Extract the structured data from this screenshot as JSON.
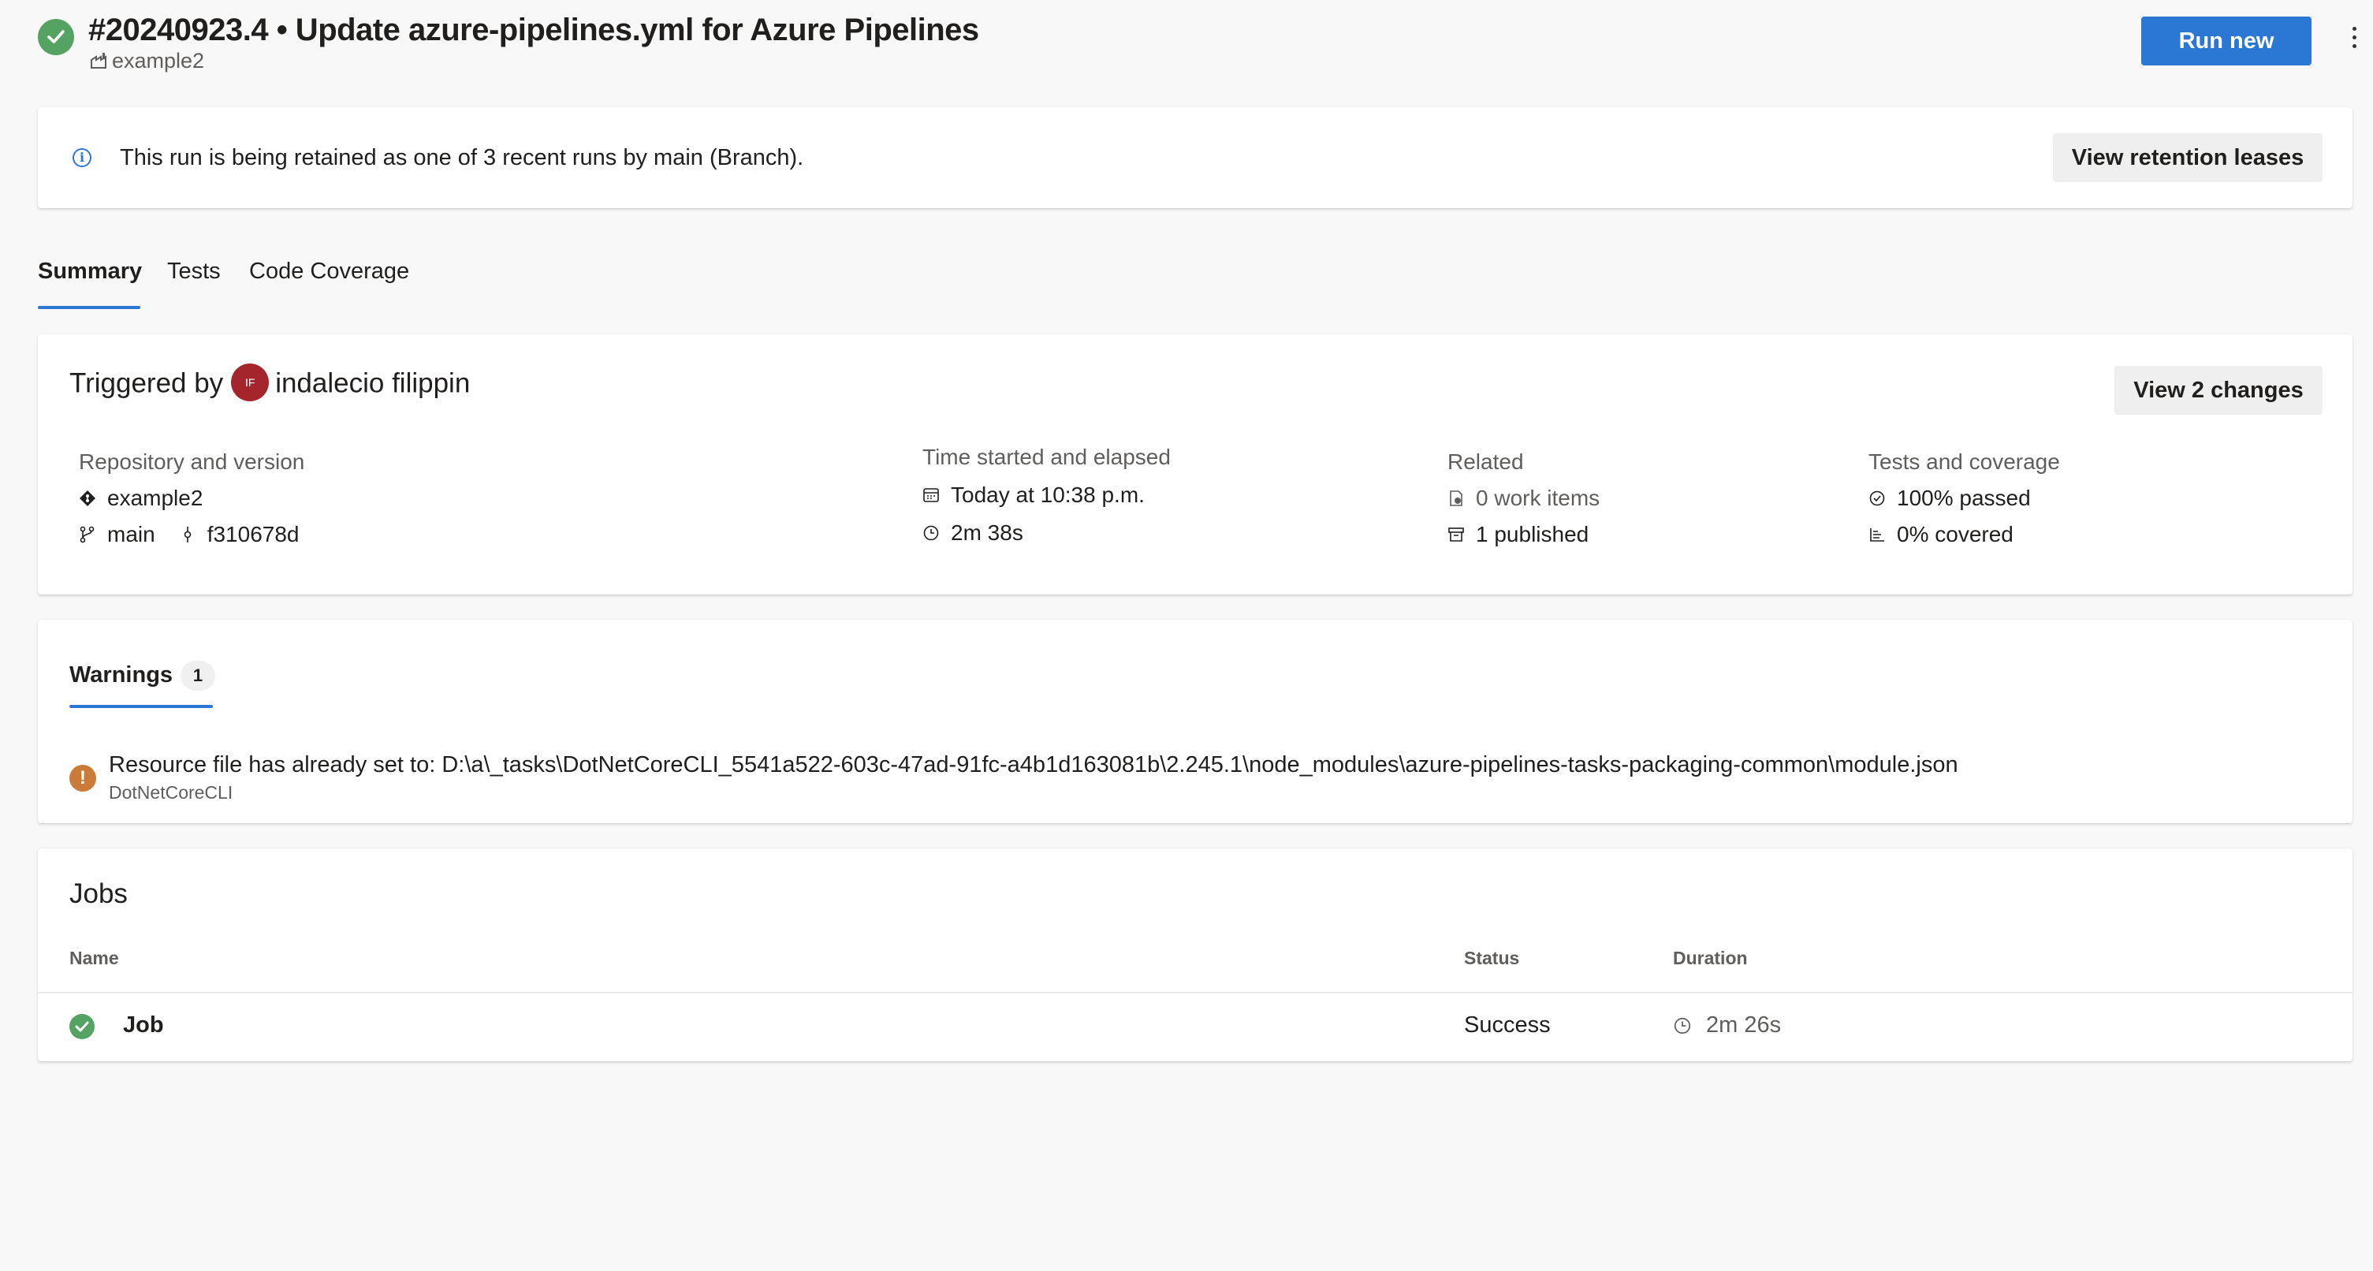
{
  "header": {
    "title": "#20240923.4 • Update azure-pipelines.yml for Azure Pipelines",
    "pipeline_name": "example2",
    "run_new_label": "Run new"
  },
  "banner": {
    "message": "This run is being retained as one of 3 recent runs by main (Branch).",
    "button_label": "View retention leases"
  },
  "tabs": [
    {
      "label": "Summary",
      "selected": true
    },
    {
      "label": "Tests",
      "selected": false
    },
    {
      "label": "Code Coverage",
      "selected": false
    }
  ],
  "summary": {
    "triggered_prefix": "Triggered by",
    "avatar_initials": "IF",
    "user_name": "indalecio filippin",
    "view_changes_label": "View 2 changes",
    "repository": {
      "label": "Repository and version",
      "repo_name": "example2",
      "branch": "main",
      "commit": "f310678d"
    },
    "time": {
      "label": "Time started and elapsed",
      "started": "Today at 10:38 p.m.",
      "elapsed": "2m 38s"
    },
    "related": {
      "label": "Related",
      "work_items": "0 work items",
      "published": "1 published"
    },
    "tests": {
      "label": "Tests and coverage",
      "passed": "100% passed",
      "covered": "0% covered"
    }
  },
  "warnings": {
    "tab_label": "Warnings",
    "count": "1",
    "items": [
      {
        "message": "Resource file has already set to: D:\\a\\_tasks\\DotNetCoreCLI_5541a522-603c-47ad-91fc-a4b1d163081b\\2.245.1\\node_modules\\azure-pipelines-tasks-packaging-common\\module.json",
        "source": "DotNetCoreCLI"
      }
    ]
  },
  "jobs": {
    "title": "Jobs",
    "columns": [
      "Name",
      "Status",
      "Duration"
    ],
    "rows": [
      {
        "name": "Job",
        "status": "Success",
        "duration": "2m 26s"
      }
    ]
  },
  "colors": {
    "accent": "#2b78d4",
    "success": "#55a362",
    "warning": "#ca7b38",
    "avatar": "#a4262c"
  }
}
